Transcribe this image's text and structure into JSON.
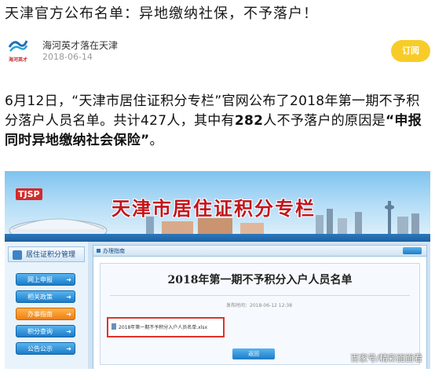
{
  "article": {
    "title": "天津官方公布名单：异地缴纳社保，不予落户！",
    "paragraph": {
      "p1": "6月12日，“天津市居住证积分专栏”官网公布了2018年第一期不予积分落户人员名单。共计427人，其中有",
      "highlight_count": "282",
      "p2": "人不予落户的原因是",
      "highlight_reason": "“申报同时异地缴纳社会保险”",
      "p3": "。"
    }
  },
  "account": {
    "logo_text": "海河英才",
    "name": "海河英才落在天津",
    "date": "2018-06-14",
    "follow_label": "订阅"
  },
  "screenshot": {
    "tjsp_logo": "TJSP",
    "banner_title": "天津市居住证积分专栏",
    "sidebar_head": "居住证积分管理",
    "sidebar_items": [
      "网上申报",
      "相关政策",
      "办事指南",
      "积分查询",
      "公告公示"
    ],
    "active_item_index": 2,
    "content_head": "办理指南",
    "notice_title": "2018年第一期不予积分入户人员名单",
    "notice_date": "发布时间：2018-06-12 12:38",
    "attachment": "2018年第一期不予积分入户人员名单.xlsx",
    "back_button": "返回"
  },
  "watermark": "百家号/精彩面面看",
  "colors": {
    "follow_button": "#f8cc28",
    "banner_title": "#c2151b",
    "highlight_box": "#e0322c",
    "nav_blue": "#1c7cc9"
  }
}
